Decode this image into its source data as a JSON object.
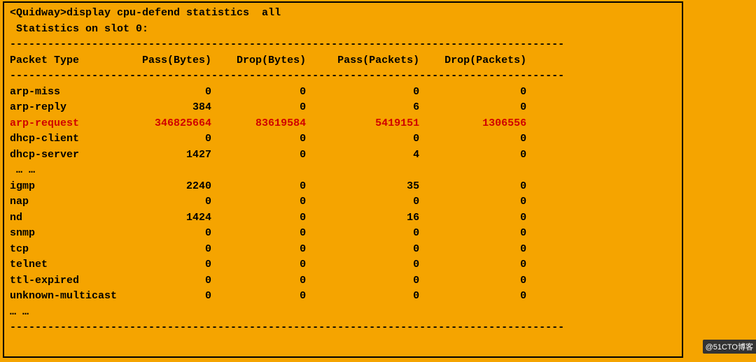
{
  "terminal": {
    "prompt_prefix": "<Quidway>",
    "command": "display cpu-defend statistics  all",
    "subtitle": " Statistics on slot 0:",
    "separator": "----------------------------------------------------------------------------------------",
    "headers": [
      "Packet Type",
      "Pass(Bytes)",
      "Drop(Bytes)",
      "Pass(Packets)",
      "Drop(Packets)"
    ],
    "ellipsis1": " … …",
    "ellipsis2": "… …",
    "rows_top": [
      {
        "name": "arp-miss",
        "pass_bytes": "0",
        "drop_bytes": "0",
        "pass_packets": "0",
        "drop_packets": "0",
        "hl": false
      },
      {
        "name": "arp-reply",
        "pass_bytes": "384",
        "drop_bytes": "0",
        "pass_packets": "6",
        "drop_packets": "0",
        "hl": false
      },
      {
        "name": "arp-request",
        "pass_bytes": "346825664",
        "drop_bytes": "83619584",
        "pass_packets": "5419151",
        "drop_packets": "1306556",
        "hl": true
      },
      {
        "name": "dhcp-client",
        "pass_bytes": "0",
        "drop_bytes": "0",
        "pass_packets": "0",
        "drop_packets": "0",
        "hl": false
      },
      {
        "name": "dhcp-server",
        "pass_bytes": "1427",
        "drop_bytes": "0",
        "pass_packets": "4",
        "drop_packets": "0",
        "hl": false
      }
    ],
    "rows_bottom": [
      {
        "name": "igmp",
        "pass_bytes": "2240",
        "drop_bytes": "0",
        "pass_packets": "35",
        "drop_packets": "0",
        "hl": false
      },
      {
        "name": "nap",
        "pass_bytes": "0",
        "drop_bytes": "0",
        "pass_packets": "0",
        "drop_packets": "0",
        "hl": false
      },
      {
        "name": "nd",
        "pass_bytes": "1424",
        "drop_bytes": "0",
        "pass_packets": "16",
        "drop_packets": "0",
        "hl": false
      },
      {
        "name": "snmp",
        "pass_bytes": "0",
        "drop_bytes": "0",
        "pass_packets": "0",
        "drop_packets": "0",
        "hl": false
      },
      {
        "name": "tcp",
        "pass_bytes": "0",
        "drop_bytes": "0",
        "pass_packets": "0",
        "drop_packets": "0",
        "hl": false
      },
      {
        "name": "telnet",
        "pass_bytes": "0",
        "drop_bytes": "0",
        "pass_packets": "0",
        "drop_packets": "0",
        "hl": false
      },
      {
        "name": "ttl-expired",
        "pass_bytes": "0",
        "drop_bytes": "0",
        "pass_packets": "0",
        "drop_packets": "0",
        "hl": false
      },
      {
        "name": "unknown-multicast",
        "pass_bytes": "0",
        "drop_bytes": "0",
        "pass_packets": "0",
        "drop_packets": "0",
        "hl": false
      }
    ],
    "col_widths": {
      "name": 20,
      "col": 15,
      "col_last": 14
    }
  },
  "watermark": "@51CTO博客"
}
